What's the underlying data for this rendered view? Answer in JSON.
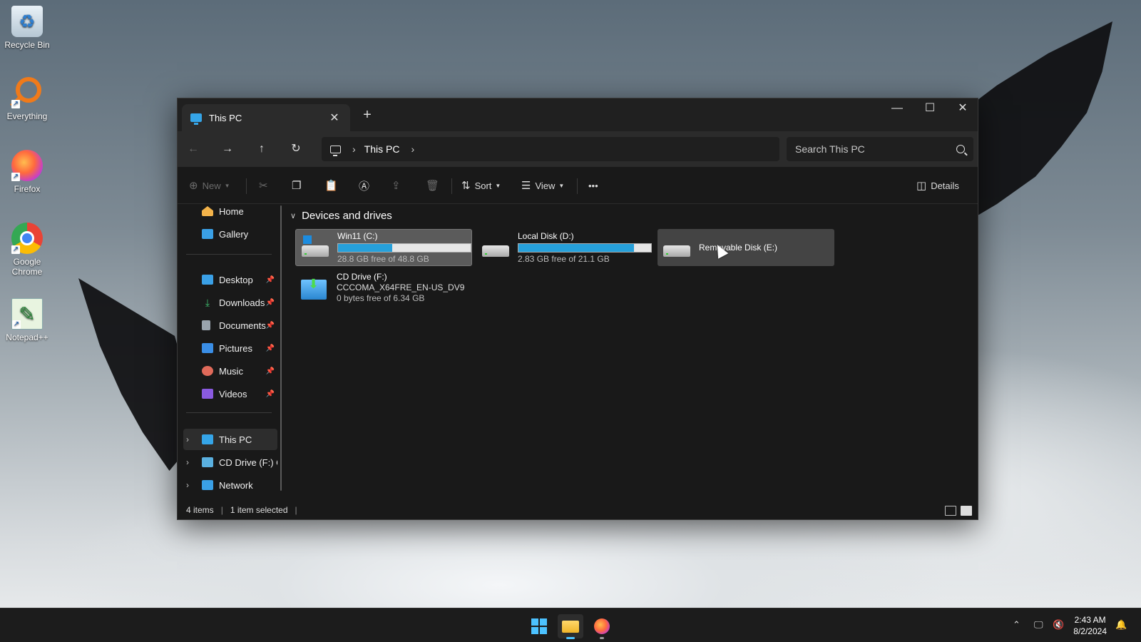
{
  "desktop": {
    "icons": [
      {
        "label": "Recycle Bin",
        "icon": "recycle-bin-icon"
      },
      {
        "label": "Everything",
        "icon": "everything-search-icon"
      },
      {
        "label": "Firefox",
        "icon": "firefox-icon"
      },
      {
        "label": "Google Chrome",
        "icon": "chrome-icon"
      },
      {
        "label": "Notepad++",
        "icon": "notepad-plus-plus-icon"
      }
    ]
  },
  "window": {
    "tab_title": "This PC",
    "breadcrumb": [
      "This PC"
    ],
    "search_placeholder": "Search This PC",
    "command_bar": {
      "new_label": "New",
      "sort_label": "Sort",
      "view_label": "View",
      "more_label": "•••",
      "details_label": "Details"
    },
    "sidebar": {
      "quick": [
        {
          "label": "Home",
          "icon": "home-icon",
          "color": "#f3b34a"
        },
        {
          "label": "Gallery",
          "icon": "gallery-icon",
          "color": "#3aa0e6"
        }
      ],
      "pinned": [
        {
          "label": "Desktop",
          "icon": "desktop-folder-icon",
          "color": "#3aa0e6"
        },
        {
          "label": "Downloads",
          "icon": "downloads-icon",
          "color": "#3fbf6f"
        },
        {
          "label": "Documents",
          "icon": "documents-icon",
          "color": "#9aa4ad"
        },
        {
          "label": "Pictures",
          "icon": "pictures-icon",
          "color": "#3a8ee6"
        },
        {
          "label": "Music",
          "icon": "music-icon",
          "color": "#e06a5a"
        },
        {
          "label": "Videos",
          "icon": "videos-icon",
          "color": "#8a5ae0"
        }
      ],
      "tree": [
        {
          "label": "This PC",
          "icon": "this-pc-icon",
          "color": "#35a5e8",
          "selected": true
        },
        {
          "label": "CD Drive (F:) CC",
          "icon": "cd-drive-icon",
          "color": "#5ab0e0",
          "selected": false
        },
        {
          "label": "Network",
          "icon": "network-icon",
          "color": "#3aa0e6",
          "selected": false
        }
      ]
    },
    "content": {
      "group_title": "Devices and drives",
      "drives": [
        {
          "name": "Win11 (C:)",
          "free_text": "28.8 GB free of 48.8 GB",
          "used_fraction": 0.41,
          "selected": true
        },
        {
          "name": "Local Disk (D:)",
          "free_text": "2.83 GB free of 21.1 GB",
          "used_fraction": 0.87,
          "selected": false
        },
        {
          "name": "Removable Disk (E:)",
          "free_text": "",
          "used_fraction": null,
          "selected": false
        },
        {
          "name": "CD Drive (F:)",
          "subtitle": "CCCOMA_X64FRE_EN-US_DV9",
          "free_text": "0 bytes free of 6.34 GB",
          "selected": false
        }
      ]
    },
    "status": {
      "items": "4 items",
      "selection": "1 item selected"
    }
  },
  "taskbar": {
    "time": "2:43 AM",
    "date": "8/2/2024",
    "accent": "#4cc2ff"
  }
}
